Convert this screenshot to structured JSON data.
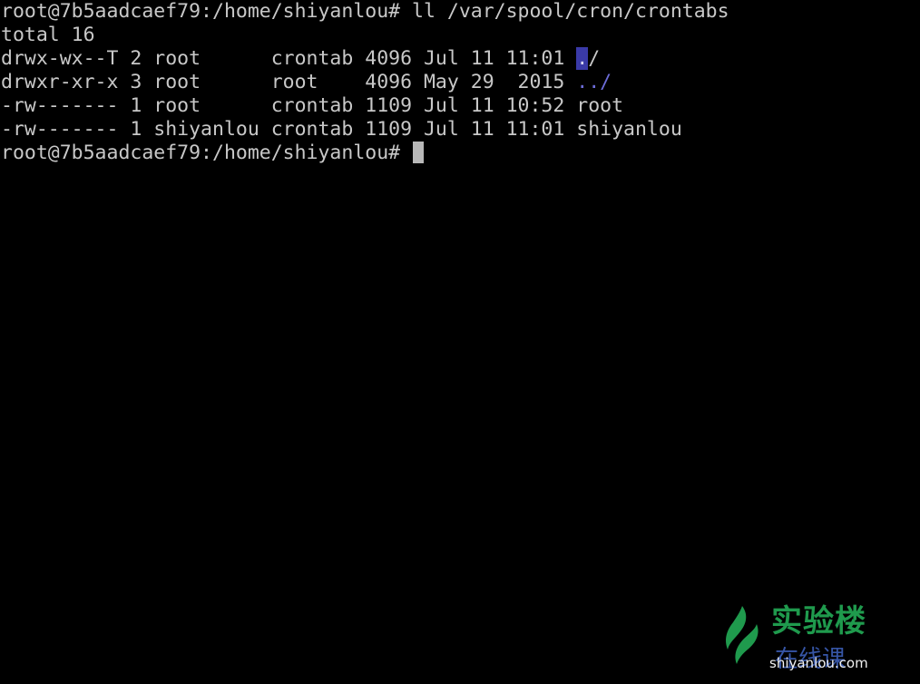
{
  "terminal": {
    "command_line": {
      "prompt": "root@7b5aadcaef79:/home/shiyanlou# ",
      "command": "ll /var/spool/cron/crontabs"
    },
    "total_line": "total 16",
    "entries": [
      {
        "meta": "drwx-wx--T 2 root      crontab 4096 Jul 11 11:01 ",
        "name_hl": ".",
        "name_rest": "/"
      },
      {
        "meta": "drwxr-xr-x 3 root      root    4096 May 29  2015 ",
        "name": "../"
      },
      {
        "meta": "-rw------- 1 root      crontab 1109 Jul 11 10:52 ",
        "name": "root"
      },
      {
        "meta": "-rw------- 1 shiyanlou crontab 1109 Jul 11 11:01 ",
        "name": "shiyanlou"
      }
    ],
    "current_prompt": "root@7b5aadcaef79:/home/shiyanlou# ",
    "colors": {
      "background": "#000000",
      "foreground": "#c8c8c8",
      "directory": "#6c6cd8",
      "highlight_bg": "#3a3aa8",
      "cursor": "#b8b8b8"
    }
  },
  "watermark": {
    "title": "实验楼",
    "subtitle": "在线课",
    "url": "shiyanlou.com",
    "colors": {
      "title": "#1f9a4d",
      "subtitle": "#3c5fb8"
    }
  }
}
